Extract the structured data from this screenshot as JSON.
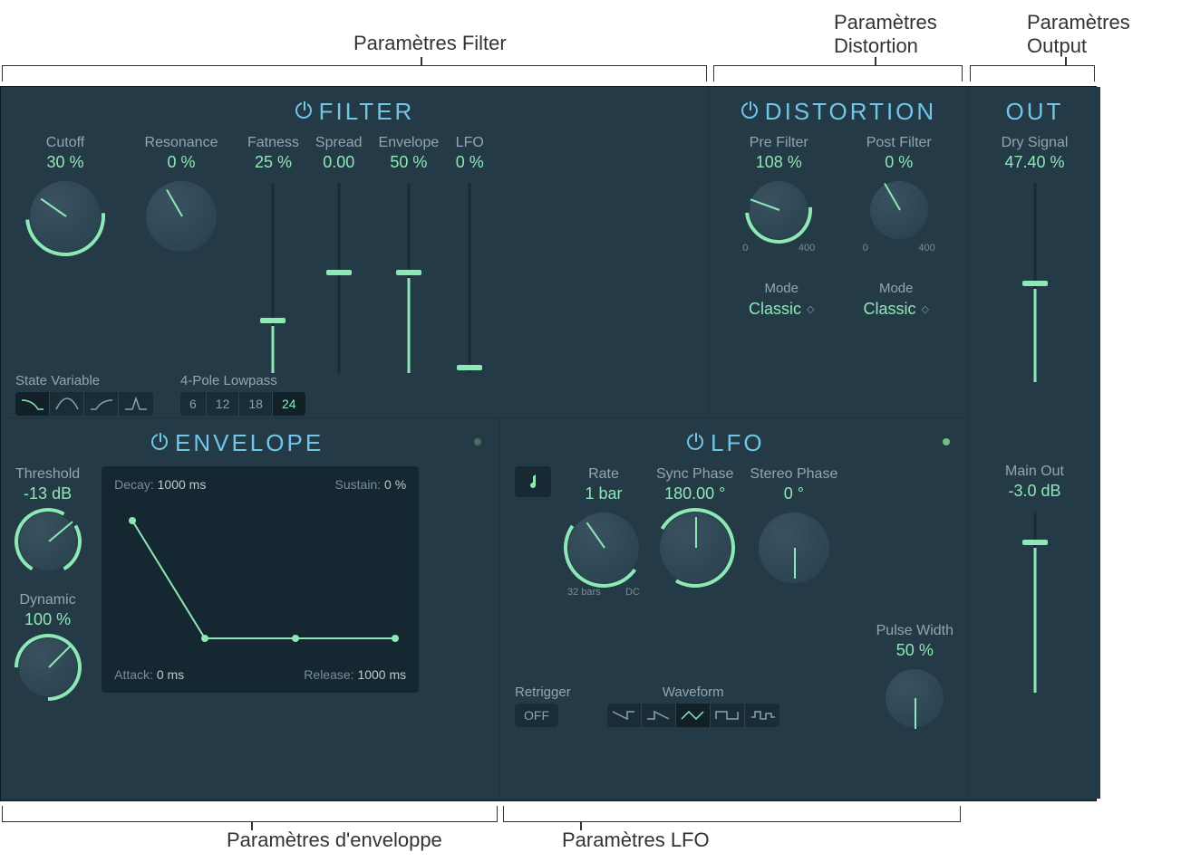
{
  "annotations": {
    "filter": "Paramètres Filter",
    "distortion": "Paramètres\nDistortion",
    "output": "Paramètres\nOutput",
    "envelope": "Paramètres d'enveloppe",
    "lfo": "Paramètres LFO"
  },
  "filter": {
    "title": "FILTER",
    "cutoff": {
      "label": "Cutoff",
      "value": "30 %",
      "pct": 30
    },
    "resonance": {
      "label": "Resonance",
      "value": "0 %",
      "pct": 0
    },
    "fatness": {
      "label": "Fatness",
      "value": "25 %",
      "pct": 25
    },
    "spread": {
      "label": "Spread",
      "value": "0.00",
      "pct": 50
    },
    "envelope": {
      "label": "Envelope",
      "value": "50 %",
      "pct": 50
    },
    "lfo": {
      "label": "LFO",
      "value": "0 %",
      "pct": 0
    },
    "state_var_label": "State Variable",
    "pole_label": "4-Pole Lowpass",
    "poles": [
      "6",
      "12",
      "18",
      "24"
    ],
    "pole_selected": "24"
  },
  "distortion": {
    "title": "DISTORTION",
    "pre": {
      "label": "Pre Filter",
      "value": "108 %",
      "pct": 27,
      "min": "0",
      "max": "400"
    },
    "post": {
      "label": "Post Filter",
      "value": "0 %",
      "pct": 0,
      "min": "0",
      "max": "400"
    },
    "mode_label": "Mode",
    "mode_pre": "Classic",
    "mode_post": "Classic"
  },
  "out": {
    "title": "OUT",
    "dry": {
      "label": "Dry Signal",
      "value": "47.40 %",
      "pct": 47
    },
    "main": {
      "label": "Main Out",
      "value": "-3.0 dB",
      "pct": 80
    }
  },
  "envelope": {
    "title": "ENVELOPE",
    "threshold": {
      "label": "Threshold",
      "value": "-13 dB",
      "pct": 70
    },
    "dynamic": {
      "label": "Dynamic",
      "value": "100 %",
      "pct": 100
    },
    "graph": {
      "decay_label": "Decay:",
      "decay": "1000 ms",
      "sustain_label": "Sustain:",
      "sustain": "0 %",
      "attack_label": "Attack:",
      "attack": "0 ms",
      "release_label": "Release:",
      "release": "1000 ms"
    }
  },
  "lfo": {
    "title": "LFO",
    "rate": {
      "label": "Rate",
      "value": "1 bar",
      "pct": 50,
      "min": "32 bars",
      "max": "DC"
    },
    "sync_phase": {
      "label": "Sync Phase",
      "value": "180.00 °",
      "pct": 100
    },
    "stereo_phase": {
      "label": "Stereo Phase",
      "value": "0 °",
      "pct": 50
    },
    "pulse_width": {
      "label": "Pulse Width",
      "value": "50 %",
      "pct": 50
    },
    "retrigger_label": "Retrigger",
    "retrigger": "OFF",
    "waveform_label": "Waveform"
  }
}
